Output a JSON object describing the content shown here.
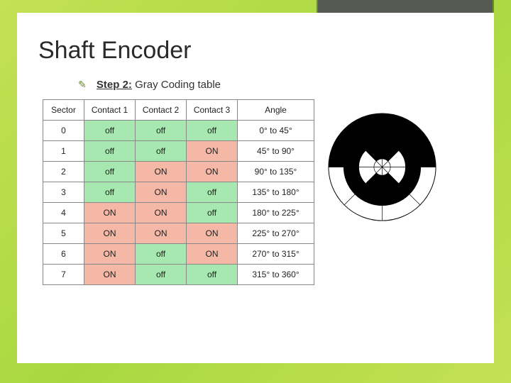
{
  "title": "Shaft Encoder",
  "bullet_prefix": "Step 2:",
  "bullet_rest": " Gray Coding table",
  "headers": [
    "Sector",
    "Contact 1",
    "Contact 2",
    "Contact 3",
    "Angle"
  ],
  "rows": [
    {
      "sector": "0",
      "c1": "off",
      "c2": "off",
      "c3": "off",
      "angle": "0° to 45°"
    },
    {
      "sector": "1",
      "c1": "off",
      "c2": "off",
      "c3": "ON",
      "angle": "45° to 90°"
    },
    {
      "sector": "2",
      "c1": "off",
      "c2": "ON",
      "c3": "ON",
      "angle": "90° to 135°"
    },
    {
      "sector": "3",
      "c1": "off",
      "c2": "ON",
      "c3": "off",
      "angle": "135° to 180°"
    },
    {
      "sector": "4",
      "c1": "ON",
      "c2": "ON",
      "c3": "off",
      "angle": "180° to 225°"
    },
    {
      "sector": "5",
      "c1": "ON",
      "c2": "ON",
      "c3": "ON",
      "angle": "225° to 270°"
    },
    {
      "sector": "6",
      "c1": "ON",
      "c2": "off",
      "c3": "ON",
      "angle": "270° to 315°"
    },
    {
      "sector": "7",
      "c1": "ON",
      "c2": "off",
      "c3": "off",
      "angle": "315° to 360°"
    }
  ]
}
